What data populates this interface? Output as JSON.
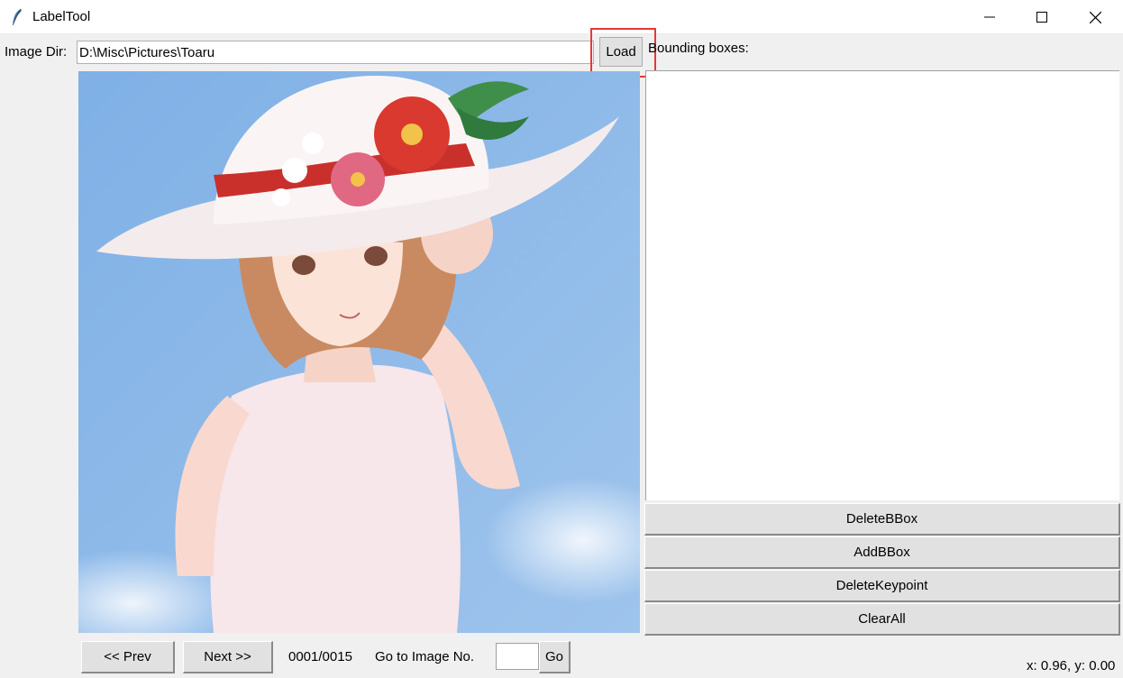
{
  "window": {
    "title": "LabelTool",
    "minimize_icon": "minimize-icon",
    "maximize_icon": "maximize-icon",
    "close_icon": "close-icon"
  },
  "image_dir": {
    "label": "Image Dir:",
    "value": "D:\\Misc\\Pictures\\Toaru",
    "load_label": "Load",
    "highlight_color": "#e53935"
  },
  "bboxes": {
    "label": "Bounding boxes:",
    "items": []
  },
  "actions": {
    "delete_bbox": "DeleteBBox",
    "add_bbox": "AddBBox",
    "delete_keypoint": "DeleteKeypoint",
    "clear_all": "ClearAll"
  },
  "navigation": {
    "prev_label": "<< Prev",
    "next_label": "Next >>",
    "progress": "0001/0015",
    "goto_label": "Go to Image No.",
    "goto_value": "",
    "go_label": "Go"
  },
  "status": {
    "coords": "x: 0.96, y: 0.00"
  },
  "image": {
    "description_icon": "anime-girl-sunhat-image",
    "sky_color": "#8fb6e3"
  }
}
